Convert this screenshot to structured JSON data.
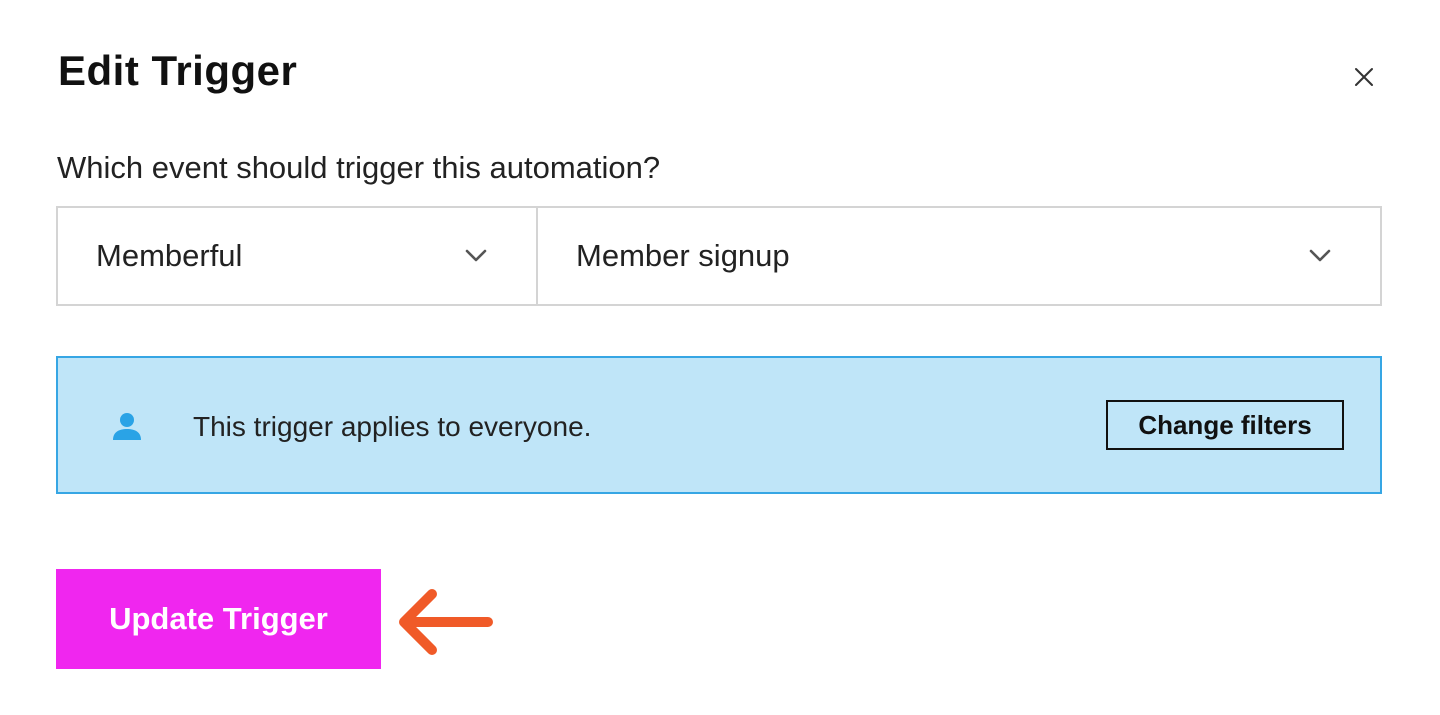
{
  "modal": {
    "title": "Edit Trigger",
    "close_icon": "close-icon"
  },
  "trigger": {
    "question": "Which event should trigger this automation?",
    "source_select": {
      "value": "Memberful",
      "icon": "chevron-down-icon"
    },
    "event_select": {
      "value": "Member signup",
      "icon": "chevron-down-icon"
    }
  },
  "filter_banner": {
    "icon": "person-icon",
    "text": "This trigger applies to everyone.",
    "button_label": "Change filters",
    "colors": {
      "background": "#bfe5f8",
      "border": "#36a6e4",
      "icon": "#2aa3e6"
    }
  },
  "actions": {
    "update_label": "Update Trigger",
    "update_color": "#f026ef",
    "annotation_arrow_icon": "arrow-left-icon",
    "annotation_color": "#f05a28"
  }
}
